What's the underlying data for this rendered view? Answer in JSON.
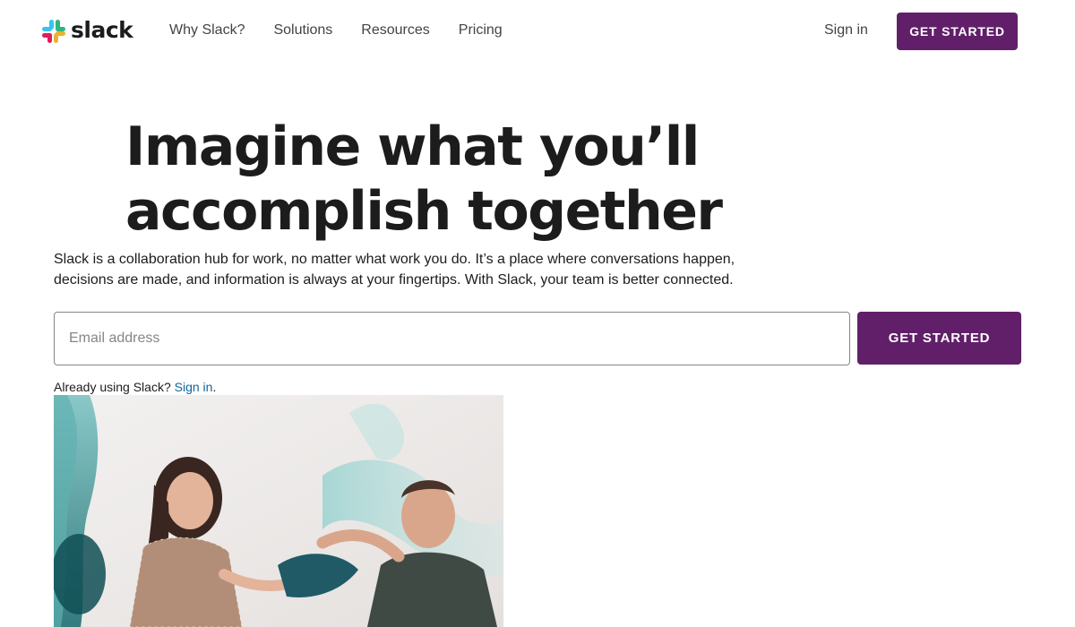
{
  "header": {
    "logo_text": "slack",
    "nav": [
      {
        "label": "Why Slack?"
      },
      {
        "label": "Solutions"
      },
      {
        "label": "Resources"
      },
      {
        "label": "Pricing"
      }
    ],
    "signin_label": "Sign in",
    "cta_label": "GET STARTED"
  },
  "hero": {
    "title": "Imagine what you’ll accomplish together",
    "subtitle": "Slack is a collaboration hub for work, no matter what work you do. It’s a place where conversations happen, decisions are made, and information is always at your fingertips. With Slack, your team is better connected."
  },
  "signup": {
    "email_placeholder": "Email address",
    "email_value": "",
    "cta_label": "GET STARTED",
    "already_prefix": "Already using Slack? ",
    "signin_link": "Sign in",
    "already_suffix": "."
  },
  "colors": {
    "brand": "#611f69",
    "link": "#1264a3",
    "text": "#1d1c1d",
    "logo": [
      "#36c5f0",
      "#2eb67d",
      "#ecb22e",
      "#e01e5a"
    ]
  },
  "icons": {
    "logo": "slack-logo-icon"
  }
}
